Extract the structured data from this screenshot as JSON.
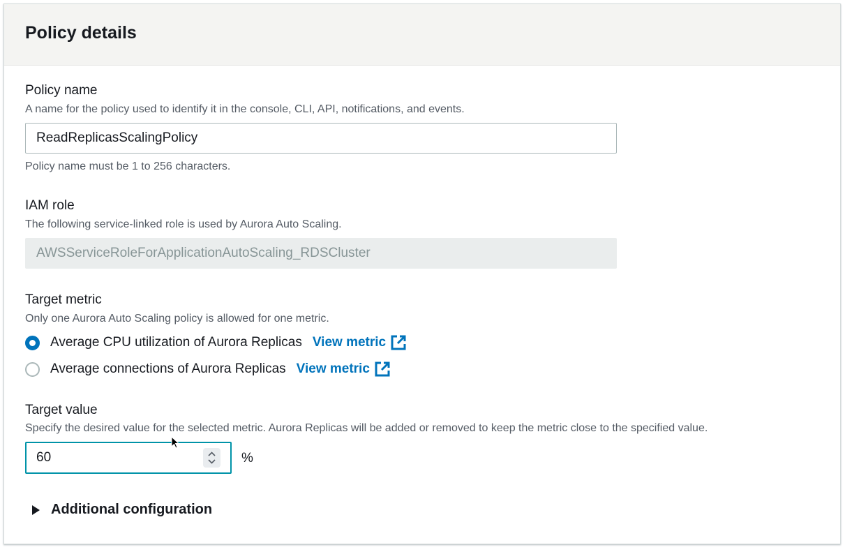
{
  "panel": {
    "title": "Policy details"
  },
  "policy_name": {
    "label": "Policy name",
    "description": "A name for the policy used to identify it in the console, CLI, API, notifications, and events.",
    "value": "ReadReplicasScalingPolicy",
    "constraint": "Policy name must be 1 to 256 characters."
  },
  "iam_role": {
    "label": "IAM role",
    "description": "The following service-linked role is used by Aurora Auto Scaling.",
    "value": "AWSServiceRoleForApplicationAutoScaling_RDSCluster"
  },
  "target_metric": {
    "label": "Target metric",
    "description": "Only one Aurora Auto Scaling policy is allowed for one metric.",
    "options": [
      {
        "label": "Average CPU utilization of Aurora Replicas",
        "link": "View metric",
        "selected": true
      },
      {
        "label": "Average connections of Aurora Replicas",
        "link": "View metric",
        "selected": false
      }
    ]
  },
  "target_value": {
    "label": "Target value",
    "description": "Specify the desired value for the selected metric. Aurora Replicas will be added or removed to keep the metric close to the specified value.",
    "value": "60",
    "unit": "%"
  },
  "additional_configuration": {
    "label": "Additional configuration",
    "expanded": false
  },
  "colors": {
    "link": "#0073bb",
    "focus_border": "#0093a8",
    "header_bg": "#f4f4f2"
  },
  "icons": {
    "external_link": "external-link-icon",
    "caret": "caret-right-icon",
    "spinner": "number-spinner-icon",
    "cursor": "mouse-pointer-icon"
  }
}
